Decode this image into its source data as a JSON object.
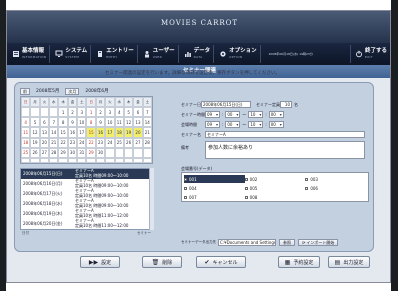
{
  "app": {
    "title": "MOVIES CARROT"
  },
  "menu": {
    "items": [
      {
        "label": "基本情報",
        "sub": "INFORMATION",
        "icon": "info-icon"
      },
      {
        "label": "システム",
        "sub": "SYSTEM",
        "icon": "monitor-icon"
      },
      {
        "label": "エントリー",
        "sub": "ENTRY",
        "icon": "entry-icon"
      },
      {
        "label": "ユーザー",
        "sub": "USER",
        "icon": "user-icon"
      },
      {
        "label": "データ",
        "sub": "DATA",
        "icon": "data-icon"
      },
      {
        "label": "オプション",
        "sub": "OPTION",
        "icon": "gear-icon"
      }
    ],
    "datetime": "2008年06月18日(水) 19時23分",
    "exit": {
      "label": "終了する",
      "sub": "EXIT",
      "icon": "power-icon"
    }
  },
  "section": {
    "title": "セミナー関連"
  },
  "instruction": "セミナー関連の設定を行います。詳細な項目を設定後、保存ボタンを押してください。",
  "calendar": {
    "prev_button": "前",
    "next_button": "次月",
    "left_month": "2008年5月",
    "right_month": "2008年6月",
    "weekdays": [
      "日",
      "月",
      "火",
      "水",
      "木",
      "金",
      "土"
    ]
  },
  "schedule": {
    "rows": [
      {
        "date": "2008年06月15日(日)",
        "line1": "セミナーA",
        "line2": "定員10名 時間09:00～10:00",
        "selected": true
      },
      {
        "date": "2008年06月16日(月)",
        "line1": "セミナーA",
        "line2": "定員10名 時間09:00～10:00",
        "selected": false
      },
      {
        "date": "2008年06月17日(火)",
        "line1": "セミナーA",
        "line2": "定員10名 時間09:00～10:00",
        "selected": false
      },
      {
        "date": "2008年06月18日(水)",
        "line1": "セミナーA",
        "line2": "定員10名 時間09:00～10:00",
        "selected": false
      },
      {
        "date": "2008年06月19日(木)",
        "line1": "セミナーA",
        "line2": "定員10名 時間11:00～12:00",
        "selected": false
      },
      {
        "date": "2008年06月20日(金)",
        "line1": "セミナーA",
        "line2": "定員10名 時間11:00～12:00",
        "selected": false
      }
    ],
    "footer_left": "日付",
    "footer_right": "セミナー"
  },
  "form": {
    "date_label": "セミナー日",
    "date_value": "2008年06月15日(日)",
    "capacity_label": "セミナー定員",
    "capacity_value": "10",
    "capacity_unit": "名",
    "time_label": "セミナー時間",
    "time": {
      "start_h": "09",
      "start_m": "00",
      "sep": "～",
      "end_h": "10",
      "end_m": "00"
    },
    "venue_label": "会場時間",
    "venue": {
      "start_h": "09",
      "start_m": "00",
      "sep": "～",
      "end_h": "10",
      "end_m": "00"
    },
    "name_label": "セミナー名",
    "name_value": "セミナーA",
    "note_label": "備考",
    "note_value": "参加人数に余裕あり"
  },
  "rooms": {
    "label": "会場番号(データ)",
    "items": [
      "001",
      "002",
      "003",
      "004",
      "005",
      "006",
      "007",
      "008"
    ]
  },
  "export": {
    "label": "セミナーデータ出力先",
    "path": "C:¥Documents and Settings¥",
    "browse": "参照",
    "import": "インポート開始"
  },
  "footer": {
    "settings": "設定",
    "delete": "削除",
    "cancel": "キャンセル",
    "reserve": "予約設定",
    "output": "出力設定"
  }
}
